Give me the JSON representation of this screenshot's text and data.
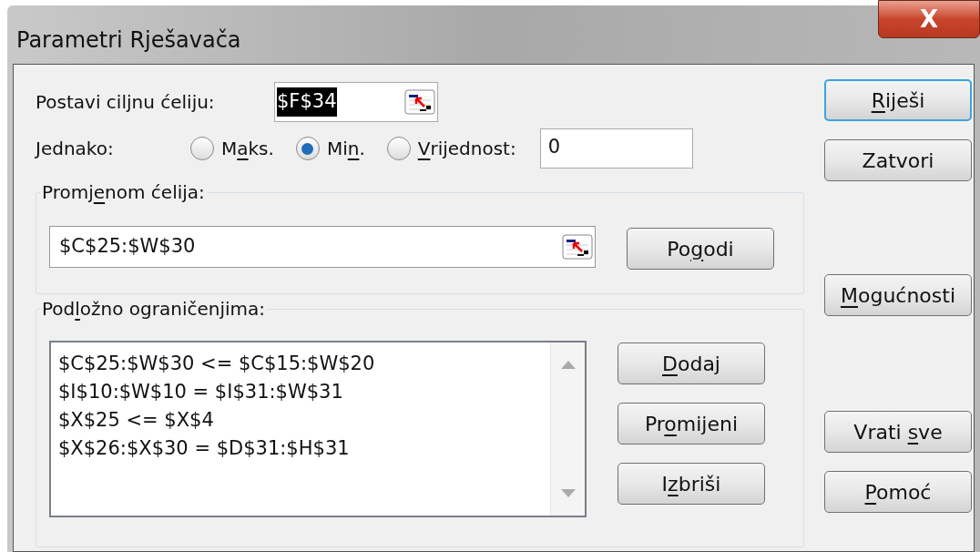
{
  "window": {
    "title": "Parametri Rješavača",
    "close": "X"
  },
  "target": {
    "label": {
      "pre": "Postavi ciljnu ćeliju:"
    },
    "value": "$F$34",
    "value_selected": true
  },
  "equal": {
    "label": {
      "pre": "Jednako:"
    },
    "options": [
      {
        "label": {
          "pre": "M",
          "key": "a",
          "post": "ks."
        },
        "selected": false
      },
      {
        "label": {
          "pre": "Mi",
          "key": "n",
          "post": "."
        },
        "selected": true
      },
      {
        "label": {
          "key": "V",
          "post": "rijednost:"
        },
        "selected": false
      }
    ],
    "value": "0"
  },
  "changing": {
    "label": {
      "pre": "Promj",
      "key": "e",
      "post": "nom ćelija:"
    },
    "value": "$C$25:$W$30",
    "button": {
      "pre": "Po",
      "key": "g",
      "post": "odi"
    }
  },
  "constraints": {
    "label": {
      "pre": "Pod",
      "key": "l",
      "post": "ožno ograničenjima:"
    },
    "items": [
      "$C$25:$W$30 <= $C$15:$W$20",
      "$I$10:$W$10 = $I$31:$W$31",
      "$X$25 <= $X$4",
      "$X$26:$X$30 = $D$31:$H$31"
    ],
    "buttons": [
      {
        "key": "D",
        "post": "odaj"
      },
      {
        "pre": "Pr",
        "key": "o",
        "post": "mijeni"
      },
      {
        "pre": "I",
        "key": "z",
        "post": "briši"
      }
    ]
  },
  "side_buttons": [
    {
      "label": {
        "key": "R",
        "post": "iješi"
      },
      "default": true
    },
    {
      "label": {
        "pre": "Zatvori"
      },
      "default": false
    },
    {
      "label": {
        "key": "M",
        "post": "ogućnosti"
      },
      "default": false
    },
    {
      "label": {
        "pre": "Vrati ",
        "key": "s",
        "post": "ve"
      },
      "default": false
    },
    {
      "label": {
        "key": "P",
        "post": "omoć"
      },
      "default": false
    }
  ]
}
